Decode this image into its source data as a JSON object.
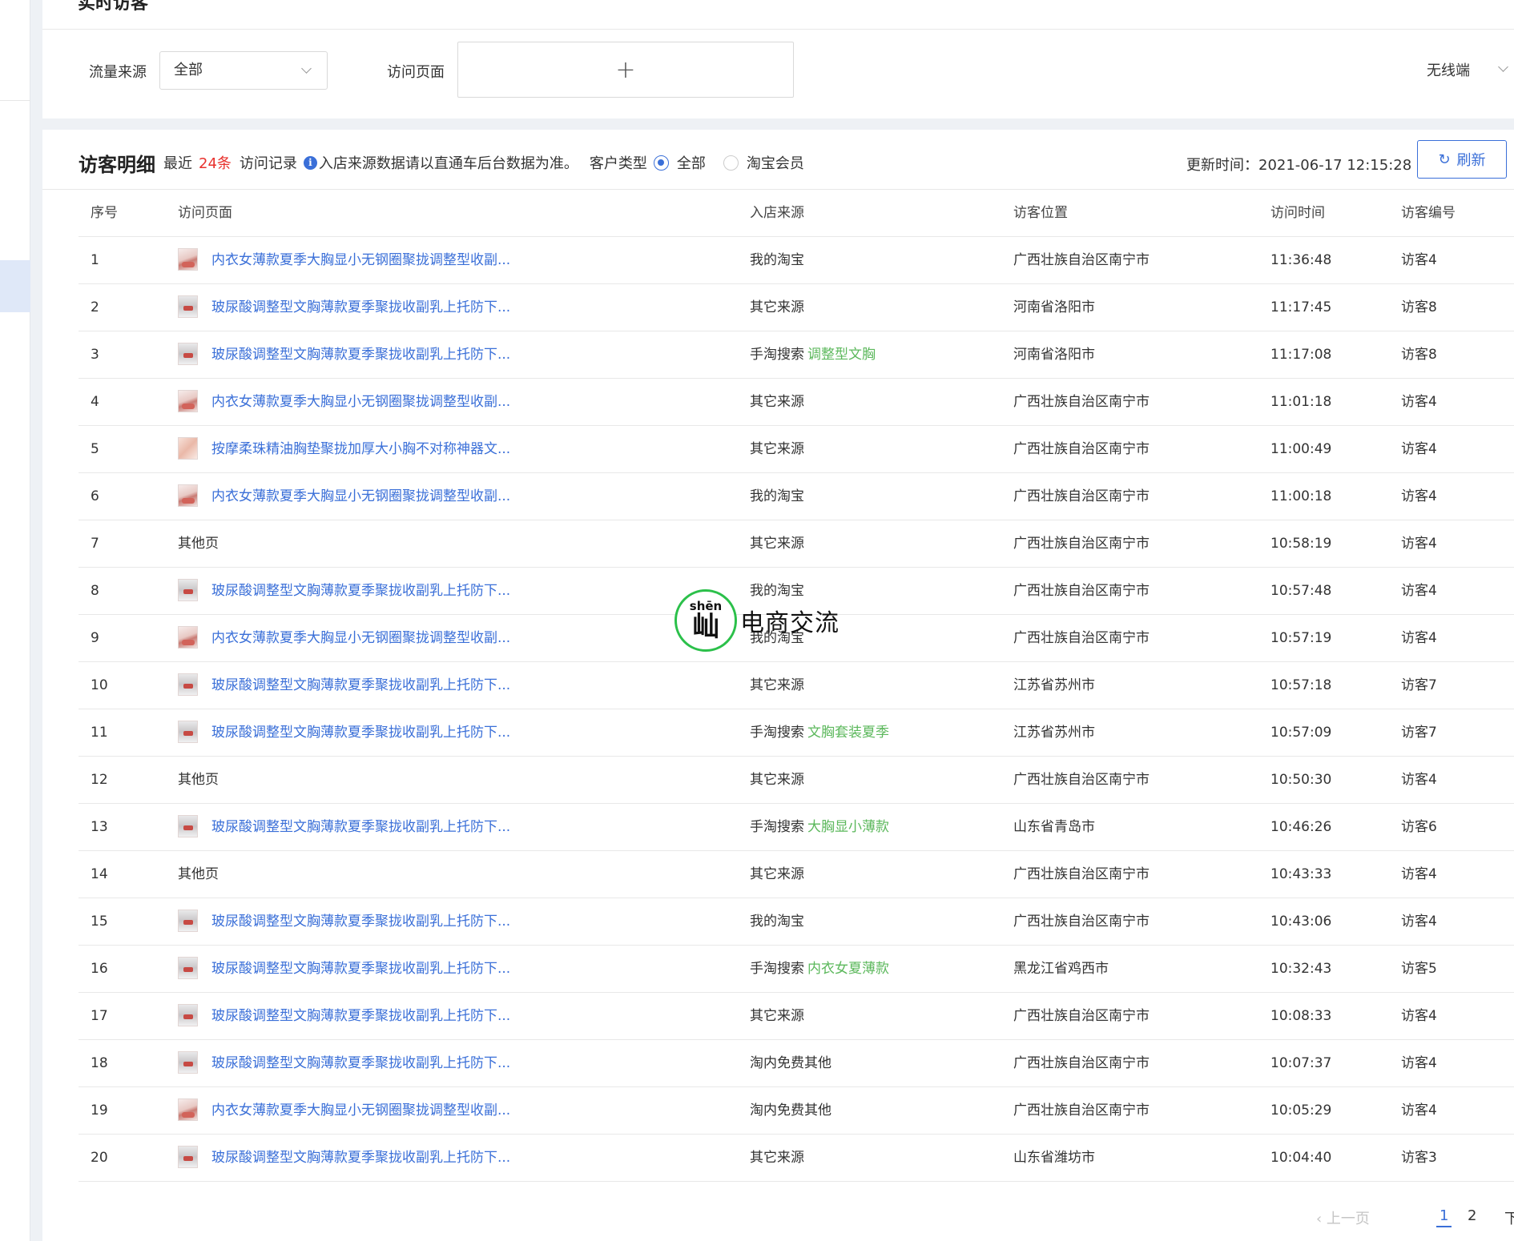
{
  "top": {
    "title": "实时访客",
    "traffic_label": "流量来源",
    "traffic_value": "全部",
    "page_label": "访问页面",
    "add_symbol": "+",
    "device": "无线端"
  },
  "main": {
    "title": "访客明细",
    "recent_prefix": "最近",
    "recent_count": "24条",
    "recent_suffix": "访问记录",
    "info_symbol": "i",
    "info_text": "入店来源数据请以直通车后台数据为准。",
    "customer_type_label": "客户类型",
    "radio_all": "全部",
    "radio_member": "淘宝会员",
    "update_time": "更新时间：2021-06-17 12:15:28",
    "refresh_label": "刷新",
    "refresh_icon": "↻"
  },
  "table": {
    "headers": [
      "序号",
      "访问页面",
      "入店来源",
      "访客位置",
      "访问时间",
      "访客编号"
    ],
    "rows": [
      {
        "idx": "1",
        "page": "内衣女薄款夏季大胸显小无钢圈聚拢调整型收副...",
        "src": "我的淘宝",
        "kw": "",
        "loc": "广西壮族自治区南宁市",
        "time": "11:36:48",
        "vis": "访客4"
      },
      {
        "idx": "2",
        "page": "玻尿酸调整型文胸薄款夏季聚拢收副乳上托防下...",
        "src": "其它来源",
        "kw": "",
        "loc": "河南省洛阳市",
        "time": "11:17:45",
        "vis": "访客8"
      },
      {
        "idx": "3",
        "page": "玻尿酸调整型文胸薄款夏季聚拢收副乳上托防下...",
        "src": "手淘搜索",
        "kw": "调整型文胸",
        "loc": "河南省洛阳市",
        "time": "11:17:08",
        "vis": "访客8"
      },
      {
        "idx": "4",
        "page": "内衣女薄款夏季大胸显小无钢圈聚拢调整型收副...",
        "src": "其它来源",
        "kw": "",
        "loc": "广西壮族自治区南宁市",
        "time": "11:01:18",
        "vis": "访客4"
      },
      {
        "idx": "5",
        "page": "按摩柔珠精油胸垫聚拢加厚大小胸不对称神器文...",
        "src": "其它来源",
        "kw": "",
        "loc": "广西壮族自治区南宁市",
        "time": "11:00:49",
        "vis": "访客4"
      },
      {
        "idx": "6",
        "page": "内衣女薄款夏季大胸显小无钢圈聚拢调整型收副...",
        "src": "我的淘宝",
        "kw": "",
        "loc": "广西壮族自治区南宁市",
        "time": "11:00:18",
        "vis": "访客4"
      },
      {
        "idx": "7",
        "page": "其他页",
        "src": "其它来源",
        "kw": "",
        "loc": "广西壮族自治区南宁市",
        "time": "10:58:19",
        "vis": "访客4"
      },
      {
        "idx": "8",
        "page": "玻尿酸调整型文胸薄款夏季聚拢收副乳上托防下...",
        "src": "我的淘宝",
        "kw": "",
        "loc": "广西壮族自治区南宁市",
        "time": "10:57:48",
        "vis": "访客4"
      },
      {
        "idx": "9",
        "page": "内衣女薄款夏季大胸显小无钢圈聚拢调整型收副...",
        "src": "我的淘宝",
        "kw": "",
        "loc": "广西壮族自治区南宁市",
        "time": "10:57:19",
        "vis": "访客4"
      },
      {
        "idx": "10",
        "page": "玻尿酸调整型文胸薄款夏季聚拢收副乳上托防下...",
        "src": "其它来源",
        "kw": "",
        "loc": "江苏省苏州市",
        "time": "10:57:18",
        "vis": "访客7"
      },
      {
        "idx": "11",
        "page": "玻尿酸调整型文胸薄款夏季聚拢收副乳上托防下...",
        "src": "手淘搜索",
        "kw": "文胸套装夏季",
        "loc": "江苏省苏州市",
        "time": "10:57:09",
        "vis": "访客7"
      },
      {
        "idx": "12",
        "page": "其他页",
        "src": "其它来源",
        "kw": "",
        "loc": "广西壮族自治区南宁市",
        "time": "10:50:30",
        "vis": "访客4"
      },
      {
        "idx": "13",
        "page": "玻尿酸调整型文胸薄款夏季聚拢收副乳上托防下...",
        "src": "手淘搜索",
        "kw": "大胸显小薄款",
        "loc": "山东省青岛市",
        "time": "10:46:26",
        "vis": "访客6"
      },
      {
        "idx": "14",
        "page": "其他页",
        "src": "其它来源",
        "kw": "",
        "loc": "广西壮族自治区南宁市",
        "time": "10:43:33",
        "vis": "访客4"
      },
      {
        "idx": "15",
        "page": "玻尿酸调整型文胸薄款夏季聚拢收副乳上托防下...",
        "src": "我的淘宝",
        "kw": "",
        "loc": "广西壮族自治区南宁市",
        "time": "10:43:06",
        "vis": "访客4"
      },
      {
        "idx": "16",
        "page": "玻尿酸调整型文胸薄款夏季聚拢收副乳上托防下...",
        "src": "手淘搜索",
        "kw": "内衣女夏薄款",
        "loc": "黑龙江省鸡西市",
        "time": "10:32:43",
        "vis": "访客5"
      },
      {
        "idx": "17",
        "page": "玻尿酸调整型文胸薄款夏季聚拢收副乳上托防下...",
        "src": "其它来源",
        "kw": "",
        "loc": "广西壮族自治区南宁市",
        "time": "10:08:33",
        "vis": "访客4"
      },
      {
        "idx": "18",
        "page": "玻尿酸调整型文胸薄款夏季聚拢收副乳上托防下...",
        "src": "淘内免费其他",
        "kw": "",
        "loc": "广西壮族自治区南宁市",
        "time": "10:07:37",
        "vis": "访客4"
      },
      {
        "idx": "19",
        "page": "内衣女薄款夏季大胸显小无钢圈聚拢调整型收副...",
        "src": "淘内免费其他",
        "kw": "",
        "loc": "广西壮族自治区南宁市",
        "time": "10:05:29",
        "vis": "访客4"
      },
      {
        "idx": "20",
        "page": "玻尿酸调整型文胸薄款夏季聚拢收副乳上托防下...",
        "src": "其它来源",
        "kw": "",
        "loc": "山东省潍坊市",
        "time": "10:04:40",
        "vis": "访客3"
      }
    ]
  },
  "pagination": {
    "prev": "‹ 上一页",
    "page1": "1",
    "page2": "2",
    "next": "下一页 ›"
  },
  "watermark": {
    "pinyin": "shēn",
    "glyph": "屾",
    "text": "电商交流"
  },
  "colors": {
    "link": "#3a6fd8",
    "count": "#e8312d",
    "keyword": "#5cb85c",
    "watermark_ring": "#2bc04a"
  }
}
